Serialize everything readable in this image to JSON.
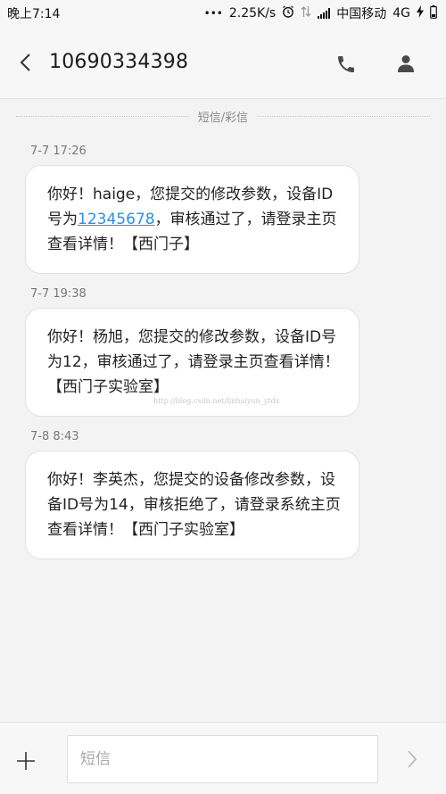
{
  "status_bar": {
    "time": "晚上7:14",
    "dots": "•••",
    "speed": "2.25K/s",
    "carrier": "中国移动",
    "network": "4G"
  },
  "header": {
    "title": "10690334398"
  },
  "divider": {
    "label": "短信/彩信"
  },
  "messages": [
    {
      "time": "7-7 17:26",
      "text_before": "你好！haige，您提交的修改参数，设备ID号为",
      "link": "12345678",
      "text_after": "，审核通过了，请登录主页查看详情！【西门子】"
    },
    {
      "time": "7-7 19:38",
      "text": "你好！杨旭，您提交的修改参数，设备ID号为12，审核通过了，请登录主页查看详情！【西门子实验室】"
    },
    {
      "time": "7-8 8:43",
      "text": "你好！李英杰，您提交的设备修改参数，设备ID号为14，审核拒绝了，请登录系统主页查看详情！【西门子实验室】"
    }
  ],
  "watermark": "http://blog.csdn.net/linhaiyun_ytdx",
  "composer": {
    "placeholder": "短信",
    "add_icon": "plus-icon",
    "send_icon": "send-arrow-icon"
  },
  "colors": {
    "link": "#2d8fde",
    "background": "#f3f3f3"
  }
}
